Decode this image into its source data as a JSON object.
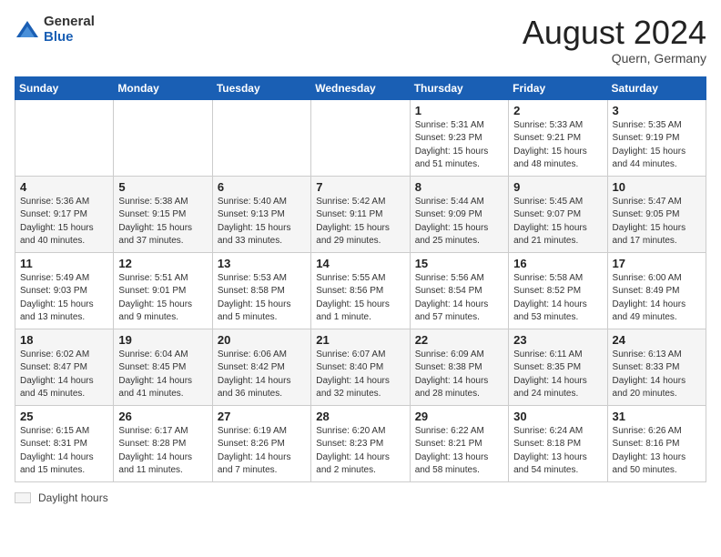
{
  "header": {
    "logo_general": "General",
    "logo_blue": "Blue",
    "month_year": "August 2024",
    "location": "Quern, Germany"
  },
  "footer": {
    "daylight_label": "Daylight hours"
  },
  "days_of_week": [
    "Sunday",
    "Monday",
    "Tuesday",
    "Wednesday",
    "Thursday",
    "Friday",
    "Saturday"
  ],
  "weeks": [
    [
      {
        "num": "",
        "info": ""
      },
      {
        "num": "",
        "info": ""
      },
      {
        "num": "",
        "info": ""
      },
      {
        "num": "",
        "info": ""
      },
      {
        "num": "1",
        "info": "Sunrise: 5:31 AM\nSunset: 9:23 PM\nDaylight: 15 hours and 51 minutes."
      },
      {
        "num": "2",
        "info": "Sunrise: 5:33 AM\nSunset: 9:21 PM\nDaylight: 15 hours and 48 minutes."
      },
      {
        "num": "3",
        "info": "Sunrise: 5:35 AM\nSunset: 9:19 PM\nDaylight: 15 hours and 44 minutes."
      }
    ],
    [
      {
        "num": "4",
        "info": "Sunrise: 5:36 AM\nSunset: 9:17 PM\nDaylight: 15 hours and 40 minutes."
      },
      {
        "num": "5",
        "info": "Sunrise: 5:38 AM\nSunset: 9:15 PM\nDaylight: 15 hours and 37 minutes."
      },
      {
        "num": "6",
        "info": "Sunrise: 5:40 AM\nSunset: 9:13 PM\nDaylight: 15 hours and 33 minutes."
      },
      {
        "num": "7",
        "info": "Sunrise: 5:42 AM\nSunset: 9:11 PM\nDaylight: 15 hours and 29 minutes."
      },
      {
        "num": "8",
        "info": "Sunrise: 5:44 AM\nSunset: 9:09 PM\nDaylight: 15 hours and 25 minutes."
      },
      {
        "num": "9",
        "info": "Sunrise: 5:45 AM\nSunset: 9:07 PM\nDaylight: 15 hours and 21 minutes."
      },
      {
        "num": "10",
        "info": "Sunrise: 5:47 AM\nSunset: 9:05 PM\nDaylight: 15 hours and 17 minutes."
      }
    ],
    [
      {
        "num": "11",
        "info": "Sunrise: 5:49 AM\nSunset: 9:03 PM\nDaylight: 15 hours and 13 minutes."
      },
      {
        "num": "12",
        "info": "Sunrise: 5:51 AM\nSunset: 9:01 PM\nDaylight: 15 hours and 9 minutes."
      },
      {
        "num": "13",
        "info": "Sunrise: 5:53 AM\nSunset: 8:58 PM\nDaylight: 15 hours and 5 minutes."
      },
      {
        "num": "14",
        "info": "Sunrise: 5:55 AM\nSunset: 8:56 PM\nDaylight: 15 hours and 1 minute."
      },
      {
        "num": "15",
        "info": "Sunrise: 5:56 AM\nSunset: 8:54 PM\nDaylight: 14 hours and 57 minutes."
      },
      {
        "num": "16",
        "info": "Sunrise: 5:58 AM\nSunset: 8:52 PM\nDaylight: 14 hours and 53 minutes."
      },
      {
        "num": "17",
        "info": "Sunrise: 6:00 AM\nSunset: 8:49 PM\nDaylight: 14 hours and 49 minutes."
      }
    ],
    [
      {
        "num": "18",
        "info": "Sunrise: 6:02 AM\nSunset: 8:47 PM\nDaylight: 14 hours and 45 minutes."
      },
      {
        "num": "19",
        "info": "Sunrise: 6:04 AM\nSunset: 8:45 PM\nDaylight: 14 hours and 41 minutes."
      },
      {
        "num": "20",
        "info": "Sunrise: 6:06 AM\nSunset: 8:42 PM\nDaylight: 14 hours and 36 minutes."
      },
      {
        "num": "21",
        "info": "Sunrise: 6:07 AM\nSunset: 8:40 PM\nDaylight: 14 hours and 32 minutes."
      },
      {
        "num": "22",
        "info": "Sunrise: 6:09 AM\nSunset: 8:38 PM\nDaylight: 14 hours and 28 minutes."
      },
      {
        "num": "23",
        "info": "Sunrise: 6:11 AM\nSunset: 8:35 PM\nDaylight: 14 hours and 24 minutes."
      },
      {
        "num": "24",
        "info": "Sunrise: 6:13 AM\nSunset: 8:33 PM\nDaylight: 14 hours and 20 minutes."
      }
    ],
    [
      {
        "num": "25",
        "info": "Sunrise: 6:15 AM\nSunset: 8:31 PM\nDaylight: 14 hours and 15 minutes."
      },
      {
        "num": "26",
        "info": "Sunrise: 6:17 AM\nSunset: 8:28 PM\nDaylight: 14 hours and 11 minutes."
      },
      {
        "num": "27",
        "info": "Sunrise: 6:19 AM\nSunset: 8:26 PM\nDaylight: 14 hours and 7 minutes."
      },
      {
        "num": "28",
        "info": "Sunrise: 6:20 AM\nSunset: 8:23 PM\nDaylight: 14 hours and 2 minutes."
      },
      {
        "num": "29",
        "info": "Sunrise: 6:22 AM\nSunset: 8:21 PM\nDaylight: 13 hours and 58 minutes."
      },
      {
        "num": "30",
        "info": "Sunrise: 6:24 AM\nSunset: 8:18 PM\nDaylight: 13 hours and 54 minutes."
      },
      {
        "num": "31",
        "info": "Sunrise: 6:26 AM\nSunset: 8:16 PM\nDaylight: 13 hours and 50 minutes."
      }
    ]
  ]
}
